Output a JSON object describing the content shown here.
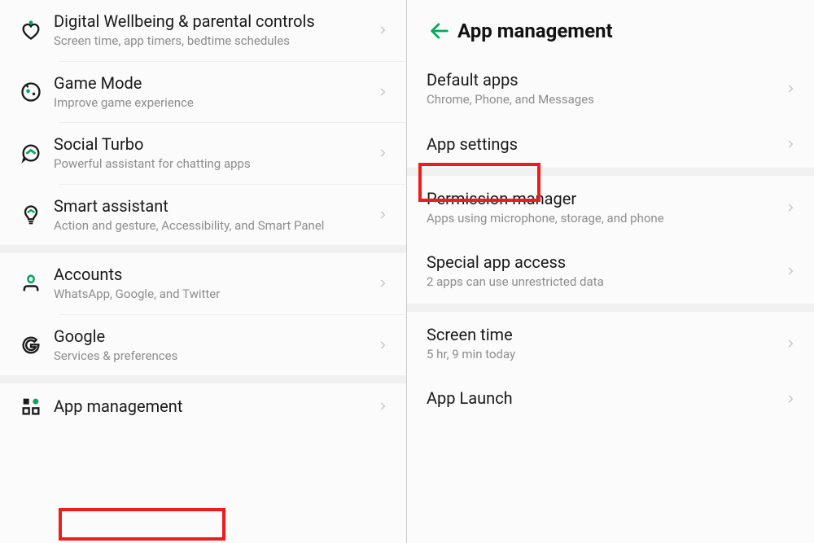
{
  "left": {
    "items": [
      {
        "title": "Digital Wellbeing & parental controls",
        "sub": "Screen time, app timers, bedtime schedules"
      },
      {
        "title": "Game Mode",
        "sub": "Improve game experience"
      },
      {
        "title": "Social Turbo",
        "sub": "Powerful assistant for chatting apps"
      },
      {
        "title": "Smart assistant",
        "sub": "Action and gesture, Accessibility, and Smart Panel"
      },
      {
        "title": "Accounts",
        "sub": "WhatsApp, Google, and Twitter"
      },
      {
        "title": "Google",
        "sub": "Services & preferences"
      },
      {
        "title": "App management",
        "sub": ""
      }
    ]
  },
  "right": {
    "header": "App management",
    "items": [
      {
        "title": "Default apps",
        "sub": "Chrome, Phone, and Messages"
      },
      {
        "title": "App settings",
        "sub": ""
      },
      {
        "title": "Permission manager",
        "sub": "Apps using microphone, storage, and phone"
      },
      {
        "title": "Special app access",
        "sub": "2 apps can use unrestricted data"
      },
      {
        "title": "Screen time",
        "sub": "5 hr, 9 min today"
      },
      {
        "title": "App Launch",
        "sub": ""
      }
    ]
  }
}
